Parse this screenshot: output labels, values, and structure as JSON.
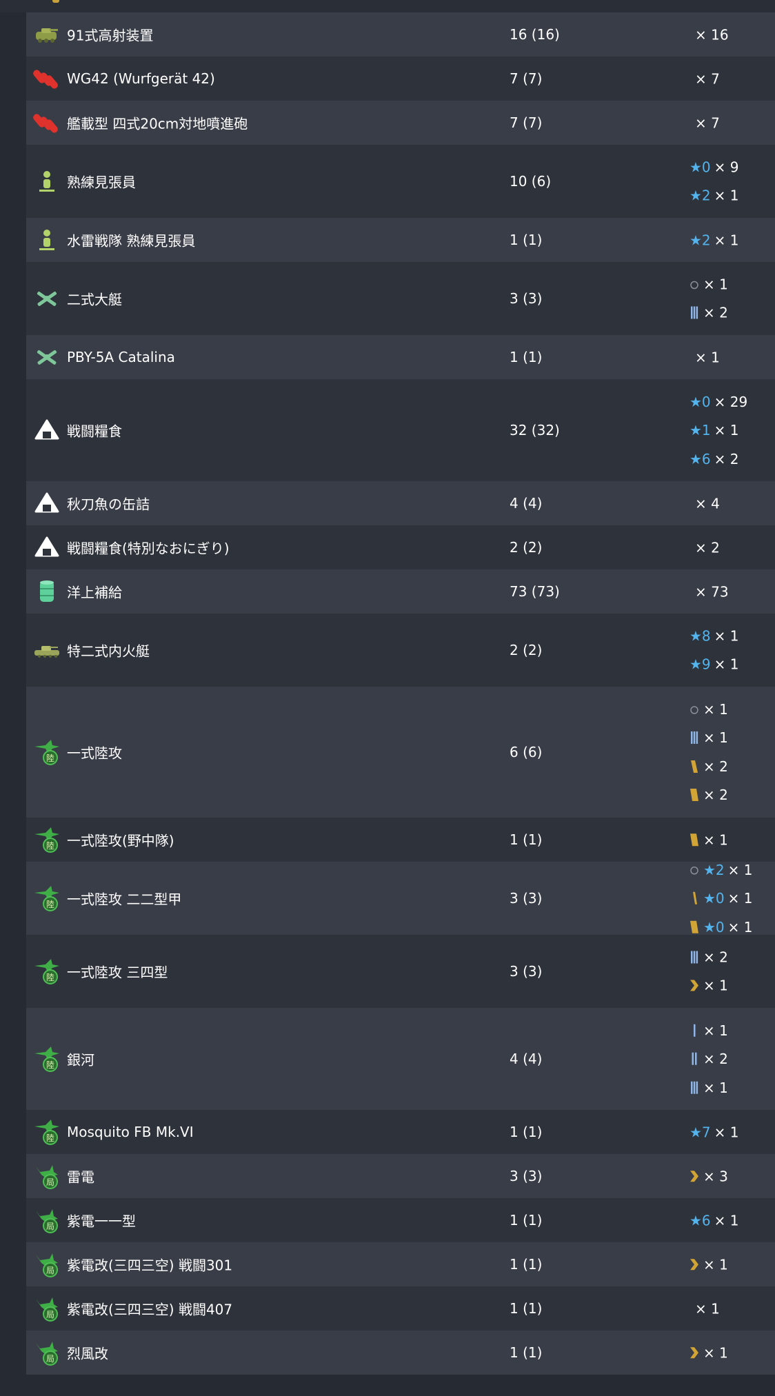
{
  "colors": {
    "row_odd": "#393d47",
    "row_even": "#2e323b",
    "background": "#262a33",
    "text": "#ffffff",
    "star": "#53b4ee",
    "proficiency_gold": "#d2a436",
    "proficiency_blue": "#8fb6e6"
  },
  "rows": [
    {
      "icon": "aa-gun-tank-icon",
      "name": "91式高射装置",
      "count": "16 (16)",
      "prof": [
        {
          "mark": "",
          "stars": "",
          "mult": "× 16"
        }
      ]
    },
    {
      "icon": "rocket-launcher-icon",
      "name": "WG42 (Wurfgerät 42)",
      "count": "7 (7)",
      "prof": [
        {
          "mark": "",
          "stars": "",
          "mult": "× 7"
        }
      ]
    },
    {
      "icon": "rocket-launcher-icon",
      "name": "艦載型 四式20cm対地噴進砲",
      "count": "7 (7)",
      "prof": [
        {
          "mark": "",
          "stars": "",
          "mult": "× 7"
        }
      ]
    },
    {
      "icon": "lookout-icon",
      "name": "熟練見張員",
      "count": "10 (6)",
      "prof": [
        {
          "mark": "",
          "stars": "★0",
          "mult": "× 9"
        },
        {
          "mark": "",
          "stars": "★2",
          "mult": "× 1"
        }
      ]
    },
    {
      "icon": "lookout-icon",
      "name": "水雷戦隊 熟練見張員",
      "count": "1 (1)",
      "prof": [
        {
          "mark": "",
          "stars": "★2",
          "mult": "× 1"
        }
      ]
    },
    {
      "icon": "flying-boat-icon",
      "name": "二式大艇",
      "count": "3 (3)",
      "prof": [
        {
          "mark": "circle",
          "stars": "",
          "mult": "× 1"
        },
        {
          "mark": "bar3",
          "stars": "",
          "mult": "× 2"
        }
      ]
    },
    {
      "icon": "flying-boat-icon",
      "name": "PBY-5A Catalina",
      "count": "1 (1)",
      "prof": [
        {
          "mark": "",
          "stars": "",
          "mult": "× 1"
        }
      ]
    },
    {
      "icon": "ration-icon",
      "name": "戦闘糧食",
      "count": "32 (32)",
      "prof": [
        {
          "mark": "",
          "stars": "★0",
          "mult": "× 29"
        },
        {
          "mark": "",
          "stars": "★1",
          "mult": "× 1"
        },
        {
          "mark": "",
          "stars": "★6",
          "mult": "× 2"
        }
      ]
    },
    {
      "icon": "ration-icon",
      "name": "秋刀魚の缶詰",
      "count": "4 (4)",
      "prof": [
        {
          "mark": "",
          "stars": "",
          "mult": "× 4"
        }
      ]
    },
    {
      "icon": "ration-icon",
      "name": "戦闘糧食(特別なおにぎり)",
      "count": "2 (2)",
      "prof": [
        {
          "mark": "",
          "stars": "",
          "mult": "× 2"
        }
      ]
    },
    {
      "icon": "supply-drum-icon",
      "name": "洋上補給",
      "count": "73 (73)",
      "prof": [
        {
          "mark": "",
          "stars": "",
          "mult": "× 73"
        }
      ]
    },
    {
      "icon": "landing-craft-icon",
      "name": "特二式内火艇",
      "count": "2 (2)",
      "prof": [
        {
          "mark": "",
          "stars": "★8",
          "mult": "× 1"
        },
        {
          "mark": "",
          "stars": "★9",
          "mult": "× 1"
        }
      ]
    },
    {
      "icon": "land-attacker-icon",
      "name": "一式陸攻",
      "count": "6 (6)",
      "prof": [
        {
          "mark": "circle",
          "stars": "",
          "mult": "× 1"
        },
        {
          "mark": "bar3",
          "stars": "",
          "mult": "× 1"
        },
        {
          "mark": "gold2",
          "stars": "",
          "mult": "× 2"
        },
        {
          "mark": "gold3",
          "stars": "",
          "mult": "× 2"
        }
      ]
    },
    {
      "icon": "land-attacker-icon",
      "name": "一式陸攻(野中隊)",
      "count": "1 (1)",
      "prof": [
        {
          "mark": "gold3",
          "stars": "",
          "mult": "× 1"
        }
      ]
    },
    {
      "icon": "land-attacker-icon",
      "name": "一式陸攻 二二型甲",
      "count": "3 (3)",
      "prof": [
        {
          "mark": "circle",
          "stars": "★2",
          "mult": "× 1"
        },
        {
          "mark": "gold1",
          "stars": "★0",
          "mult": "× 1"
        },
        {
          "mark": "gold3",
          "stars": "★0",
          "mult": "× 1"
        }
      ]
    },
    {
      "icon": "land-attacker-icon",
      "name": "一式陸攻 三四型",
      "count": "3 (3)",
      "prof": [
        {
          "mark": "bar3",
          "stars": "",
          "mult": "× 2"
        },
        {
          "mark": "chevron",
          "stars": "",
          "mult": "× 1"
        }
      ]
    },
    {
      "icon": "land-attacker-icon",
      "name": "銀河",
      "count": "4 (4)",
      "prof": [
        {
          "mark": "bar1",
          "stars": "",
          "mult": "× 1"
        },
        {
          "mark": "bar2",
          "stars": "",
          "mult": "× 2"
        },
        {
          "mark": "bar3",
          "stars": "",
          "mult": "× 1"
        }
      ]
    },
    {
      "icon": "land-attacker-icon",
      "name": "Mosquito FB Mk.VI",
      "count": "1 (1)",
      "prof": [
        {
          "mark": "",
          "stars": "★7",
          "mult": "× 1"
        }
      ]
    },
    {
      "icon": "interceptor-icon",
      "name": "雷電",
      "count": "3 (3)",
      "prof": [
        {
          "mark": "chevron",
          "stars": "",
          "mult": "× 3"
        }
      ]
    },
    {
      "icon": "interceptor-icon",
      "name": "紫電一一型",
      "count": "1 (1)",
      "prof": [
        {
          "mark": "",
          "stars": "★6",
          "mult": "× 1"
        }
      ]
    },
    {
      "icon": "interceptor-icon",
      "name": "紫電改(三四三空) 戦闘301",
      "count": "1 (1)",
      "prof": [
        {
          "mark": "chevron",
          "stars": "",
          "mult": "× 1"
        }
      ]
    },
    {
      "icon": "interceptor-icon",
      "name": "紫電改(三四三空) 戦闘407",
      "count": "1 (1)",
      "prof": [
        {
          "mark": "",
          "stars": "",
          "mult": "× 1"
        }
      ]
    },
    {
      "icon": "interceptor-icon",
      "name": "烈風改",
      "count": "1 (1)",
      "prof": [
        {
          "mark": "chevron",
          "stars": "",
          "mult": "× 1"
        }
      ]
    }
  ]
}
